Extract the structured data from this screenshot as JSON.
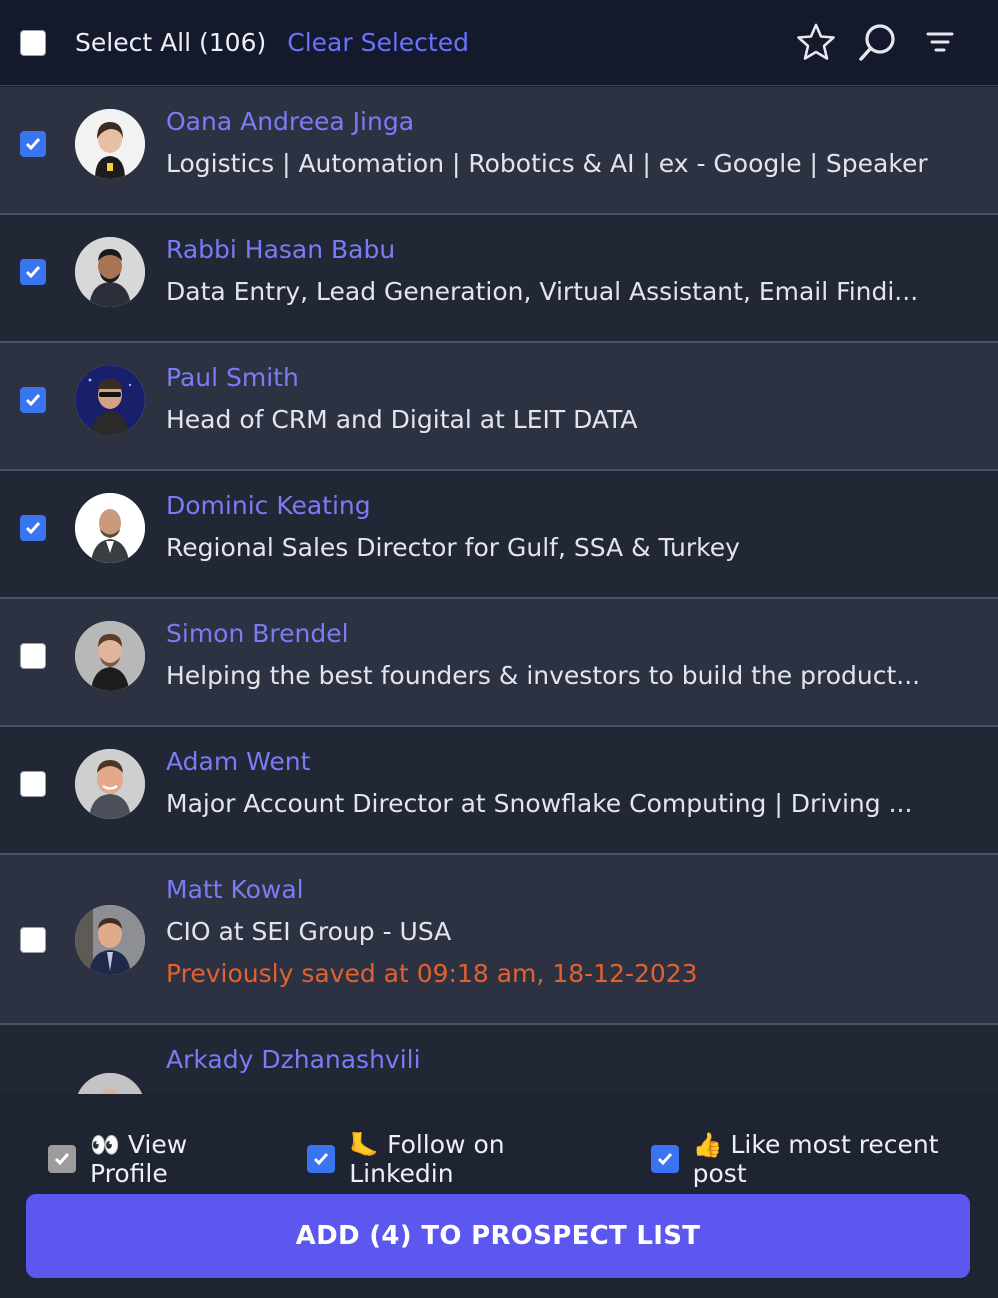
{
  "header": {
    "select_all_label": "Select All (106)",
    "clear_selected_label": "Clear Selected",
    "icons": [
      "star-icon",
      "search-icon",
      "filter-icon"
    ]
  },
  "prospects": [
    {
      "name": "Oana Andreea Jinga",
      "title": "Logistics | Automation | Robotics & AI | ex - Google | Speaker",
      "checked": true
    },
    {
      "name": "Rabbi Hasan Babu",
      "title": "Data Entry, Lead Generation, Virtual Assistant, Email Findi...",
      "checked": true
    },
    {
      "name": "Paul Smith",
      "title": "Head of CRM and Digital at LEIT DATA",
      "checked": true
    },
    {
      "name": "Dominic Keating",
      "title": "Regional Sales Director for Gulf, SSA & Turkey",
      "checked": true
    },
    {
      "name": "Simon Brendel",
      "title": "Helping the best founders & investors to build the product...",
      "checked": false
    },
    {
      "name": "Adam Went",
      "title": "Major Account Director at Snowflake Computing | Driving ...",
      "checked": false
    },
    {
      "name": "Matt Kowal",
      "title": "CIO at SEI Group - USA",
      "note": "Previously saved at 09:18 am, 18-12-2023",
      "checked": false
    },
    {
      "name": "Arkady Dzhanashvili",
      "title": "",
      "checked": false
    }
  ],
  "footer": {
    "options": [
      {
        "emoji": "👀",
        "label": "View Profile",
        "checked": true,
        "disabled": true
      },
      {
        "emoji": "🦶",
        "label": "Follow on Linkedin",
        "checked": true
      },
      {
        "emoji": "👍",
        "label": "Like most recent post",
        "checked": true
      }
    ],
    "add_button_label": "ADD (4) TO PROSPECT LIST"
  },
  "colors": {
    "accent": "#5c57ee",
    "link": "#6a72ff",
    "name": "#7a7cf5",
    "warning": "#e2612e",
    "checkbox": "#3b74f0"
  }
}
